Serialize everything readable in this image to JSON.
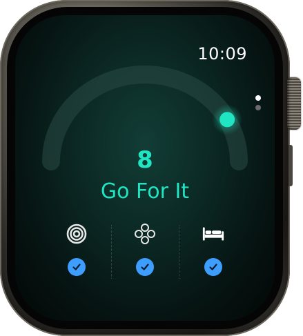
{
  "status_bar": {
    "time": "10:09"
  },
  "score": {
    "value": "8",
    "label": "Go For It",
    "arc_fraction": 0.84
  },
  "metrics": [
    {
      "icon": "activity-rings-icon",
      "completed": true
    },
    {
      "icon": "mindfulness-flower-icon",
      "completed": true
    },
    {
      "icon": "bed-icon",
      "completed": true
    }
  ],
  "pagination": {
    "current": 1,
    "total": 2
  },
  "colors": {
    "accent": "#1fe5c2",
    "check": "#3d9eff",
    "track": "#2a4a45"
  }
}
